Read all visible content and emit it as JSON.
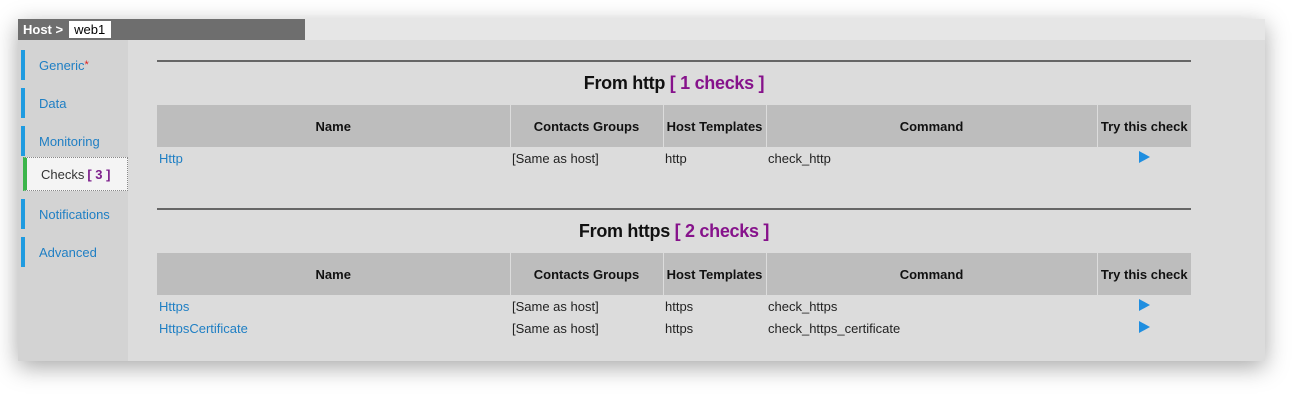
{
  "header": {
    "label": "Host >",
    "host_name": "web1"
  },
  "sidebar": {
    "items": [
      {
        "label": "Generic",
        "required_mark": "*"
      },
      {
        "label": "Data"
      },
      {
        "label": "Monitoring"
      },
      {
        "label": "Checks",
        "badge": "[ 3 ]",
        "active": true
      },
      {
        "label": "Notifications"
      },
      {
        "label": "Advanced"
      }
    ]
  },
  "columns": [
    "Name",
    "Contacts Groups",
    "Host Templates",
    "Command",
    "Try this check"
  ],
  "sections": [
    {
      "title": "From http",
      "count": "[ 1 checks ]",
      "rows": [
        {
          "name": "Http",
          "contacts": "[Same as host]",
          "template": "http",
          "command": "check_http"
        }
      ]
    },
    {
      "title": "From https",
      "count": "[ 2 checks ]",
      "rows": [
        {
          "name": "Https",
          "contacts": "[Same as host]",
          "template": "https",
          "command": "check_https"
        },
        {
          "name": "HttpsCertificate",
          "contacts": "[Same as host]",
          "template": "https",
          "command": "check_https_certificate"
        }
      ]
    }
  ],
  "icons": {
    "try": "play-icon"
  },
  "colors": {
    "link": "#1f7fc4",
    "accent": "#1f9be0",
    "active": "#3bb54a",
    "count": "#86128b"
  }
}
